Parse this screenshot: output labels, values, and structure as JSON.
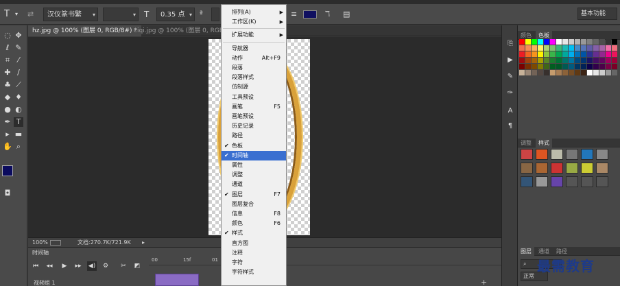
{
  "options_bar": {
    "font_family": "汉仪篆书繁",
    "font_size": "0.35 点",
    "color_swatch": "#101060"
  },
  "workspace_button": "基本功能",
  "doc_tabs": [
    {
      "label": "hz.jpg @ 100% (图层 0, RGB/8#) *",
      "active": true
    },
    {
      "label": "ciqi.jpg @ 100% (图层 0, RGB/8#)",
      "active": false
    }
  ],
  "status_bar": {
    "zoom": "100%",
    "doc_size": "文档:270.7K/721.9K"
  },
  "timeline": {
    "title": "时间轴",
    "ruler_ticks": [
      "00",
      "15f",
      "01"
    ],
    "track_label": "视频组 1"
  },
  "right_panel": {
    "tabs_top": [
      "颜色",
      "色板"
    ],
    "tabs_mid": [
      "调整",
      "样式"
    ],
    "tabs_bottom": [
      "图层",
      "通道",
      "路径"
    ],
    "blend_mode": "正常"
  },
  "menu": {
    "items": [
      {
        "label": "排列(A)",
        "submenu": true
      },
      {
        "label": "工作区(K)",
        "submenu": true
      },
      {
        "separator": true
      },
      {
        "label": "扩展功能",
        "submenu": true
      },
      {
        "separator": true
      },
      {
        "label": "导航器"
      },
      {
        "label": "动作",
        "shortcut": "Alt+F9"
      },
      {
        "label": "段落"
      },
      {
        "label": "段落样式"
      },
      {
        "label": "仿制源"
      },
      {
        "label": "工具预设"
      },
      {
        "label": "画笔",
        "shortcut": "F5"
      },
      {
        "label": "画笔预设"
      },
      {
        "label": "历史记录"
      },
      {
        "label": "路径"
      },
      {
        "label": "色板",
        "checked": true
      },
      {
        "label": "时间轴",
        "checked": true,
        "highlighted": true
      },
      {
        "label": "属性"
      },
      {
        "label": "调整"
      },
      {
        "label": "通道"
      },
      {
        "label": "图层",
        "checked": true,
        "shortcut": "F7"
      },
      {
        "label": "图层复合"
      },
      {
        "label": "信息",
        "shortcut": "F8"
      },
      {
        "label": "颜色",
        "shortcut": "F6"
      },
      {
        "label": "样式",
        "checked": true
      },
      {
        "label": "直方图"
      },
      {
        "label": "注释"
      },
      {
        "label": "字符"
      },
      {
        "label": "字符样式"
      }
    ]
  },
  "watermark": "最需教育",
  "colors": {
    "foreground": "#0b0b5e",
    "background": "#ffffff",
    "menu_highlight": "#3a6fd0"
  }
}
